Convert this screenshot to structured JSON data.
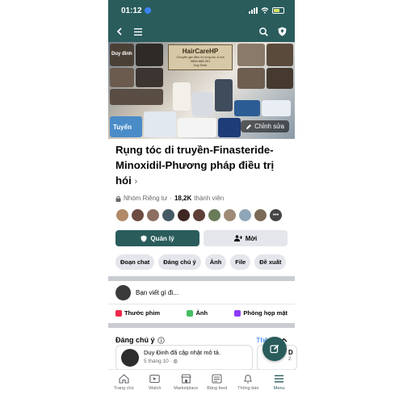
{
  "status_bar": {
    "time": "01:12"
  },
  "group": {
    "title": "Rụng tóc di truyền-Finasteride-Minoxidil-Phương pháp điều trị hói",
    "privacy": "Nhóm Riêng tư",
    "members_count": "18,2K",
    "members_label": "thành viên",
    "cover": {
      "sign_title": "HairCareHP",
      "sign_subtitle": "Chuyên gia điều trị rụng tóc & hói",
      "sign_phone": "0866.686.391",
      "sign_name": "Duy Đinh",
      "label_left": "Duy đinh",
      "label_bottom": "Tuyển",
      "edit_label": "Chỉnh sửa"
    }
  },
  "actions": {
    "manage_label": "Quản lý",
    "invite_label": "Mời"
  },
  "chips": [
    "Đoạn chat",
    "Đáng chú ý",
    "Ảnh",
    "File",
    "Đề xuất"
  ],
  "composer": {
    "placeholder": "Bạn viết gì đi..."
  },
  "post_actions": [
    {
      "label": "Thước phim",
      "color": "#f02849"
    },
    {
      "label": "Ảnh",
      "color": "#45bd62"
    },
    {
      "label": "Phòng họp mặt",
      "color": "#8c3cf7"
    }
  ],
  "featured": {
    "heading": "Đáng chú ý",
    "more_label": "Thêm",
    "card": {
      "text": "Duy Đinh đã cập nhật mô tả.",
      "date": "5 tháng 10 ·"
    },
    "card2_initial": "D",
    "card2_sub": "2"
  },
  "tabbar": [
    {
      "label": "Trang chủ",
      "icon": "home-icon"
    },
    {
      "label": "Watch",
      "icon": "watch-icon"
    },
    {
      "label": "Marketplace",
      "icon": "marketplace-icon"
    },
    {
      "label": "Bảng feed",
      "icon": "feed-icon"
    },
    {
      "label": "Thông báo",
      "icon": "bell-icon"
    },
    {
      "label": "Menu",
      "icon": "menu-icon"
    }
  ],
  "colors": {
    "brand": "#2a5c5c",
    "link": "#1877f2",
    "chip_bg": "#e4e6eb"
  }
}
